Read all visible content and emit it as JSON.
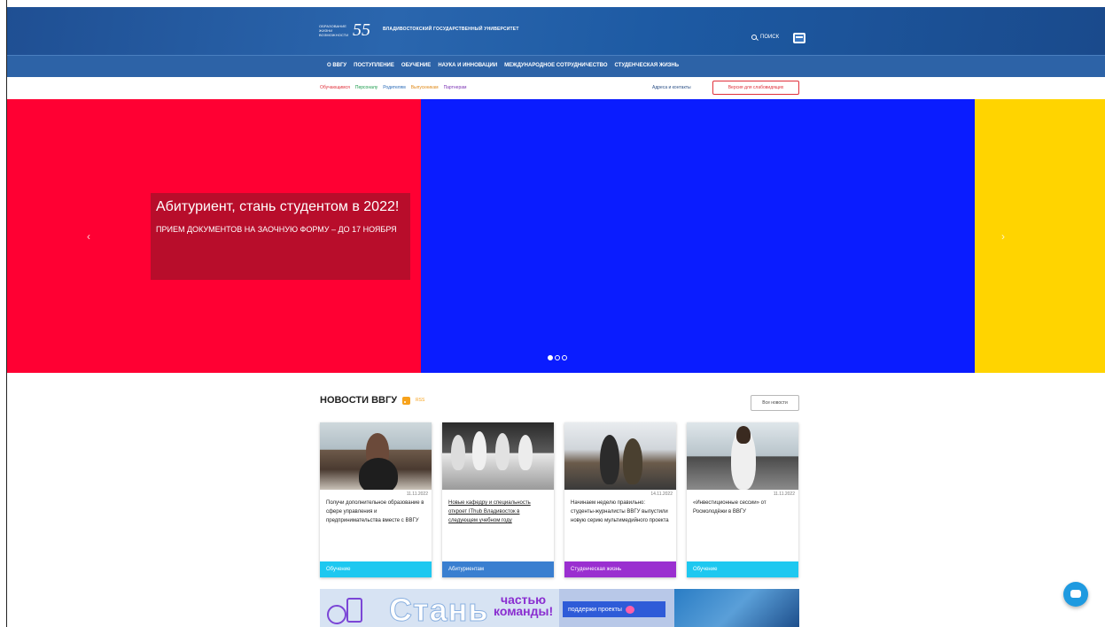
{
  "header": {
    "logo_tagline": "образование жизни возможности",
    "logo_number": "55",
    "university_name": "Владивостокский государственный университет",
    "search_label": "ПОИСК"
  },
  "main_nav": [
    "О ВВГУ",
    "ПОСТУПЛЕНИЕ",
    "ОБУЧЕНИЕ",
    "НАУКА И ИННОВАЦИИ",
    "МЕЖДУНАРОДНОЕ СОТРУДНИЧЕСТВО",
    "СТУДЕНЧЕСКАЯ ЖИЗНЬ"
  ],
  "sub_nav": {
    "roles": [
      "Обучающимся",
      "Персоналу",
      "Родителям",
      "Выпускникам",
      "Партнерам"
    ],
    "contacts": "Адреса и контакты",
    "low_vision": "Версия для слабовидящих"
  },
  "hero": {
    "title": "Абитуриент, стань студентом в 2022!",
    "subtitle": "ПРИЕМ ДОКУМЕНТОВ НА ЗАОЧНУЮ ФОРМУ – ДО 17 НОЯБРЯ",
    "prev_arrow": "‹",
    "next_arrow": "›",
    "colors": {
      "red": "#ff0033",
      "blue": "#0a1cff",
      "yellow": "#ffd400"
    }
  },
  "news": {
    "title": "НОВОСТИ ВВГУ",
    "rss_label": "RSS",
    "all_news": "Все новости",
    "cards": [
      {
        "date": "11.11.2022",
        "text": "Получи дополнительное образование в сфере управления и предпринимательства вместе с ВВГУ",
        "category": "Обучение"
      },
      {
        "date": "",
        "text": "Новые кафедру и специальность откроет IThub Владивосток в следующем учебном году",
        "category": "Абитуриентам"
      },
      {
        "date": "14.11.2022",
        "text": "Начинаем неделю правильно: студенты-журналисты ВВГУ выпустили новую серию мультимедийного проекта",
        "category": "Студенческая жизнь"
      },
      {
        "date": "11.11.2022",
        "text": "«Инвестиционные сессии» от Росмолодёжи в ВВГУ",
        "category": "Обучение"
      }
    ]
  },
  "banner": {
    "big_text": "Стань",
    "part_text_1": "частью",
    "part_text_2": "команды!",
    "button_text": "поддержи проекты"
  }
}
